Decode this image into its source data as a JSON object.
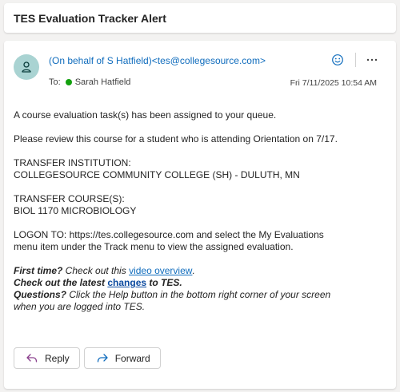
{
  "subject": "TES Evaluation Tracker Alert",
  "sender": "(On behalf of S Hatfield)<tes@collegesource.com>",
  "to_label": "To:",
  "recipient": "Sarah Hatfield",
  "timestamp": "Fri 7/11/2025 10:54 AM",
  "body": {
    "line1": "A course evaluation task(s) has been assigned to your queue.",
    "line2": "Please review this course for a student who is attending Orientation on 7/17.",
    "inst_label": "TRANSFER INSTITUTION:",
    "inst_value": "COLLEGESOURCE COMMUNITY COLLEGE (SH) - DULUTH, MN",
    "course_label": "TRANSFER COURSE(S):",
    "course_value": "BIOL 1170 MICROBIOLOGY",
    "logon_line1": "LOGON TO: https://tes.collegesource.com and select the My Evaluations",
    "logon_line2": "menu item under the Track menu to view the assigned evaluation.",
    "first_time_bold": "First time?",
    "first_time_text": " Check out this ",
    "video_link": "video overview",
    "first_time_end": ".",
    "latest_bold": "Check out the latest ",
    "changes_link": "changes",
    "latest_end": " to TES.",
    "questions_bold": "Questions?",
    "questions_text1": " Click the Help button in the bottom right corner of your screen",
    "questions_text2": "when you are logged into TES."
  },
  "actions": {
    "reply": "Reply",
    "forward": "Forward"
  },
  "icons": {
    "avatar": "person-icon",
    "emoji": "emoji-icon",
    "more": "more-icon",
    "reply": "reply-icon",
    "forward": "forward-icon",
    "presence": "presence-available-icon"
  },
  "colors": {
    "link": "#0f6cbd",
    "avatar_bg": "#a9d3d2",
    "presence": "#13a10e"
  }
}
